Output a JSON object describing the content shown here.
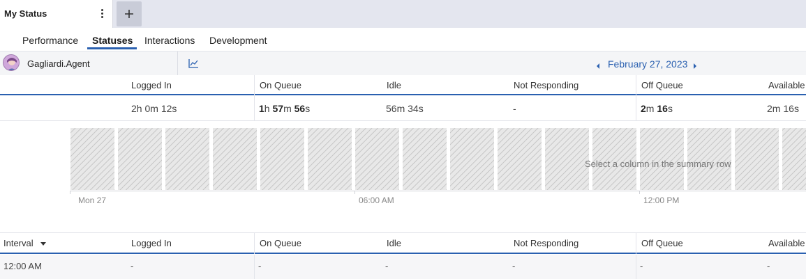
{
  "tabs": {
    "active_label": "My Status",
    "add_icon": "plus-icon",
    "menu_icon": "kebab-menu-icon"
  },
  "subtabs": [
    {
      "label": "Performance",
      "active": false
    },
    {
      "label": "Statuses",
      "active": true
    },
    {
      "label": "Interactions",
      "active": false
    },
    {
      "label": "Development",
      "active": false
    }
  ],
  "agent": {
    "name": "Gagliardi.Agent",
    "chart_icon": "line-chart-icon"
  },
  "date_nav": {
    "label": "February 27, 2023",
    "prev_icon": "caret-left-icon",
    "next_icon": "caret-right-icon"
  },
  "summary": {
    "columns": [
      "Logged In",
      "On Queue",
      "Idle",
      "Not Responding",
      "Off Queue",
      "Available"
    ],
    "values": [
      [
        {
          "n": "2",
          "u": "h "
        },
        {
          "n": "0",
          "u": "m "
        },
        {
          "n": "12",
          "u": "s"
        }
      ],
      [
        {
          "n": "1",
          "u": "h "
        },
        {
          "n": "57",
          "u": "m "
        },
        {
          "n": "56",
          "u": "s"
        }
      ],
      [
        {
          "n": "56",
          "u": "m "
        },
        {
          "n": "34",
          "u": "s"
        }
      ],
      [
        {
          "n": "-",
          "u": ""
        }
      ],
      [
        {
          "n": "2",
          "u": "m "
        },
        {
          "n": "16",
          "u": "s"
        }
      ],
      [
        {
          "n": "2",
          "u": "m "
        },
        {
          "n": "16",
          "u": "s"
        }
      ]
    ],
    "bold_numbers": [
      false,
      true,
      false,
      false,
      true,
      false
    ]
  },
  "timeline": {
    "note": "Select a column in the summary row",
    "axis_labels": [
      "Mon 27",
      "06:00 AM",
      "12:00 PM"
    ],
    "bar_count": 16
  },
  "intervals": {
    "columns": [
      "Interval",
      "Logged In",
      "On Queue",
      "Idle",
      "Not Responding",
      "Off Queue",
      "Available"
    ],
    "rows": [
      [
        "12:00 AM",
        "-",
        "-",
        "-",
        "-",
        "-",
        "-"
      ]
    ]
  },
  "colors": {
    "accent": "#2a60b0",
    "tabstrip_bg": "#e4e6ef"
  }
}
